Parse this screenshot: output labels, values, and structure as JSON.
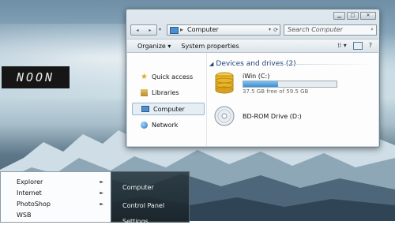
{
  "desktop": {
    "label": "NOON"
  },
  "explorer": {
    "controls": {
      "minimize": "▁",
      "maximize": "□",
      "close": "✕"
    },
    "nav": {
      "back": "◂",
      "forward": "▸",
      "recent": "▾"
    },
    "address": {
      "separator": "▸",
      "path": "Computer",
      "dropdown": "▾",
      "refresh": "⟳"
    },
    "search": {
      "placeholder": "Search Computer",
      "icon": "search-icon"
    },
    "toolbar": {
      "organize": "Organize ▾",
      "system_properties": "System properties",
      "view_icon": "⁞⁞ ▾",
      "help": "?"
    },
    "nav_pane": [
      {
        "label": "Quick access",
        "icon": "star-icon"
      },
      {
        "label": "Libraries",
        "icon": "libraries-icon"
      },
      {
        "label": "Computer",
        "icon": "computer-icon",
        "selected": true
      },
      {
        "label": "Network",
        "icon": "network-icon"
      }
    ],
    "group": {
      "title": "Devices and drives (2)",
      "toggle": "◢"
    },
    "drives": [
      {
        "name": "iWin (C:)",
        "free_text": "37.5 GB free of 59.5 GB",
        "used_fraction": 0.37
      },
      {
        "name": "BD-ROM Drive (D:)"
      }
    ]
  },
  "start_menu": {
    "left_items": [
      {
        "label": "Explorer",
        "arrow": "►"
      },
      {
        "label": "Internet",
        "arrow": "►"
      },
      {
        "label": "PhotoShop",
        "arrow": "►"
      },
      {
        "label": "WSB"
      }
    ],
    "right_items": [
      "Computer",
      "Control Panel",
      "Settings"
    ]
  },
  "colors": {
    "accent": "#1f3f78",
    "selection": "#e6eef5",
    "drive_bar": "#3d8ed2"
  }
}
